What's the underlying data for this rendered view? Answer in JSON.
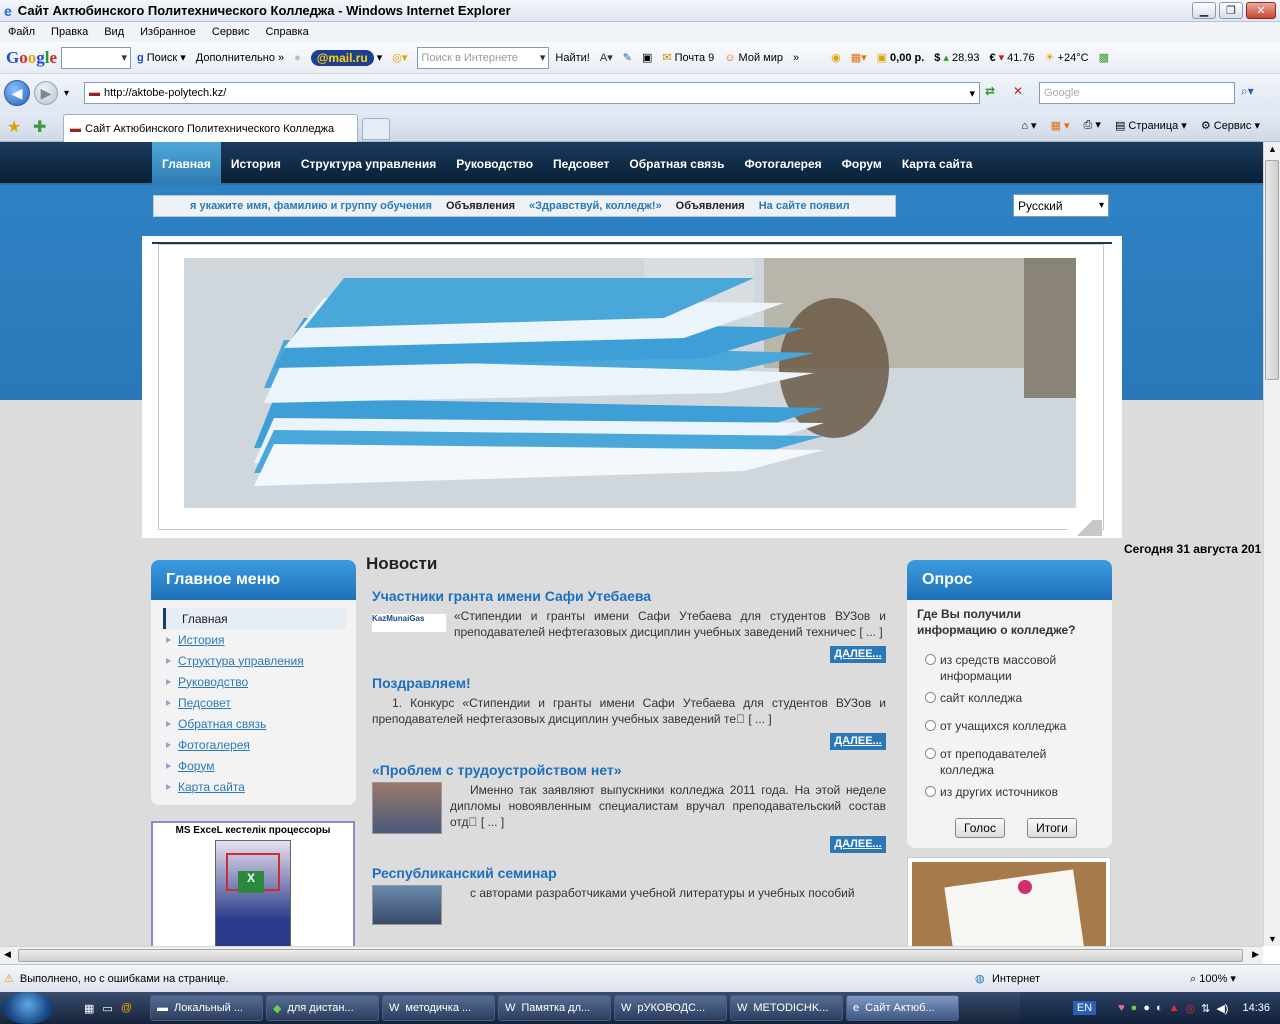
{
  "window": {
    "title": "Сайт Актюбинского Политехнического Колледжа - Windows Internet Explorer"
  },
  "menu": [
    "Файл",
    "Правка",
    "Вид",
    "Избранное",
    "Сервис",
    "Справка"
  ],
  "toolbar": {
    "google": "Google",
    "search_label": "Поиск",
    "more_label": "Дополнительно",
    "mailru": "@mail.ru",
    "search_placeholder": "Поиск в Интернете",
    "find_label": "Найти!",
    "mail_label": "Почта 9",
    "myworld_label": "Мой мир",
    "balance": "0,00 р.",
    "usd": "28.93",
    "eur": "41.76",
    "weather": "+24°C"
  },
  "address": {
    "url": "http://aktobe-polytech.kz/",
    "search_placeholder": "Google"
  },
  "tab": {
    "title": "Сайт Актюбинского Политехнического Колледжа"
  },
  "commandbar": {
    "page": "Страница",
    "tools": "Сервис"
  },
  "site": {
    "nav": [
      "Главная",
      "История",
      "Структура управления",
      "Руководство",
      "Педсовет",
      "Обратная связь",
      "Фотогалерея",
      "Форум",
      "Карта сайта"
    ],
    "ticker": [
      {
        "text": "я укажите имя, фамилию и группу обучения",
        "link": true
      },
      {
        "text": "Объявления",
        "link": false
      },
      {
        "text": "«Здравствуй, колледж!»",
        "link": true
      },
      {
        "text": "Объявления",
        "link": false
      },
      {
        "text": "На сайте появил",
        "link": true
      }
    ],
    "language": "Русский",
    "date": "Сегодня 31 августа 201",
    "main_menu": {
      "title": "Главное меню",
      "items": [
        "Главная",
        "История",
        "Структура управления",
        "Руководство",
        "Педсовет",
        "Обратная связь",
        "Фотогалерея",
        "Форум",
        "Карта сайта"
      ]
    },
    "excel_book": {
      "title": "MS ExceL кестелiк процессоры"
    },
    "news": {
      "title": "Новости",
      "more": "ДАЛЕЕ...",
      "items": [
        {
          "title": "Участники гранта имени Сафи Утебаева",
          "thumb": "KazMunaiGas",
          "text": "«Стипендии и гранты имени Сафи Утебаева для студентов ВУЗов и преподавателей нефтегазовых дисциплин учебных заведений техничес [ ... ]"
        },
        {
          "title": "Поздравляем!",
          "thumb": "",
          "text": "1. Конкурс «Стипендии и гранты имени Сафи Утебаева для студентов ВУЗов и преподавателей нефтегазовых дисциплин учебных заведений те\u0000 [ ... ]"
        },
        {
          "title": "«Проблем с трудоустройством нет»",
          "thumb": "photo",
          "text": "Именно так заявляют выпускники колледжа 2011 года. На этой неделе дипломы новоявленным специалистам вручал преподавательский состав отд\u0000 [ ... ]"
        },
        {
          "title": "Республиканский семинар",
          "thumb": "photo",
          "text": "с авторами разработчиками учебной литературы и учебных пособий"
        }
      ]
    },
    "poll": {
      "title": "Опрос",
      "question": "Где Вы получили информацию о колледже?",
      "options": [
        "из средств массовой информации",
        "сайт колледжа",
        "от учащихся колледжа",
        "от преподавателей колледжа",
        "из других источников"
      ],
      "vote": "Голос",
      "results": "Итоги"
    }
  },
  "status": {
    "text": "Выполнено, но с ошибками на странице.",
    "zone": "Интернет",
    "zoom": "100%"
  },
  "taskbar": {
    "buttons": [
      "Локальный ...",
      "для дистан...",
      "методичка ...",
      "Памятка дл...",
      "рУКОВОДС...",
      "METODICHK...",
      "Сайт Актюб..."
    ],
    "lang": "EN",
    "time": "14:36"
  },
  "colors": {
    "accent": "#2a78b8",
    "nav_bg": "#0a2035",
    "link": "#1a6fc0"
  }
}
